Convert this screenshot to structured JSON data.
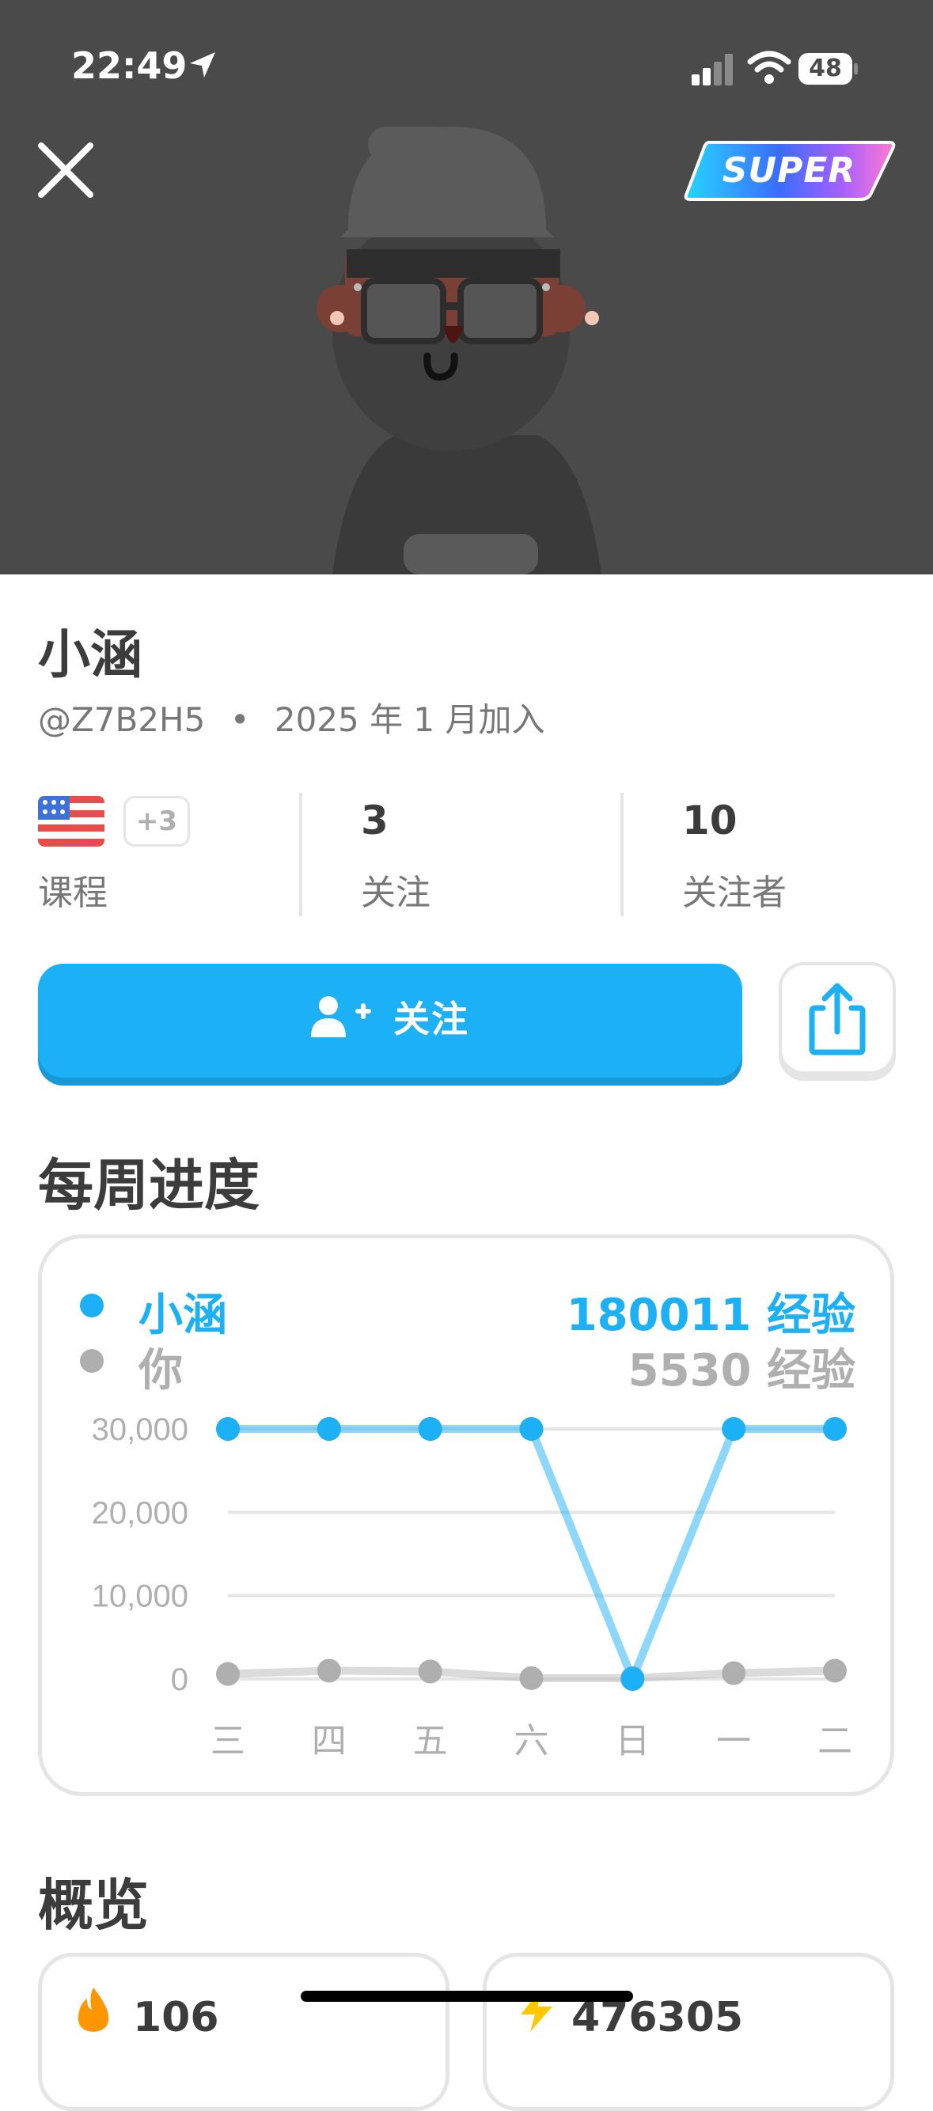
{
  "status_bar": {
    "time": "22:49",
    "battery": "48"
  },
  "header": {
    "badge_label": "SUPER"
  },
  "profile": {
    "name": "小涵",
    "username": "@Z7B2H5",
    "joined": "2025 年 1 月加入",
    "separator": "•"
  },
  "stats": {
    "courses_extra": "+3",
    "courses_label": "课程",
    "following_count": "3",
    "following_label": "关注",
    "followers_count": "10",
    "followers_label": "关注者"
  },
  "actions": {
    "follow_label": "关注"
  },
  "weekly": {
    "title": "每周进度",
    "legend": [
      {
        "name": "小涵",
        "value": "180011 经验",
        "color": "#1cb0f6"
      },
      {
        "name": "你",
        "value": "5530 经验",
        "color": "#afafaf"
      }
    ]
  },
  "chart_data": {
    "type": "line",
    "categories": [
      "三",
      "四",
      "五",
      "六",
      "日",
      "一",
      "二"
    ],
    "y_ticks": [
      "30,000",
      "20,000",
      "10,000",
      "0"
    ],
    "ylim": [
      0,
      30000
    ],
    "grid": true,
    "series": [
      {
        "name": "小涵",
        "values": [
          30000,
          30000,
          30000,
          30000,
          0,
          30000,
          30000
        ],
        "color": "#1cb0f6"
      },
      {
        "name": "你",
        "values": [
          600,
          1000,
          900,
          100,
          100,
          700,
          1000
        ],
        "color": "#afafaf"
      }
    ]
  },
  "overview": {
    "title": "概览",
    "items": [
      {
        "value": "106",
        "icon": "fire-icon"
      },
      {
        "value": "476305",
        "icon": "lightning-icon"
      }
    ]
  }
}
